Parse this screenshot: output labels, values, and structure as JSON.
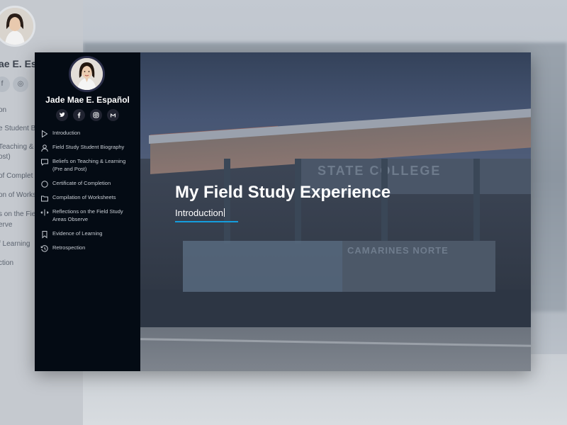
{
  "profile": {
    "name": "Jade Mae E. Español",
    "backdrop_name_fragment": "ae E. Es"
  },
  "socials": [
    {
      "id": "twitter",
      "icon": "twitter-icon",
      "glyph": "t"
    },
    {
      "id": "facebook",
      "icon": "facebook-icon",
      "glyph": "f"
    },
    {
      "id": "instagram",
      "icon": "instagram-icon",
      "glyph": "◎"
    },
    {
      "id": "gmail",
      "icon": "gmail-icon",
      "glyph": "M"
    }
  ],
  "nav": [
    {
      "label": "Introduction",
      "icon": "play-outline-icon"
    },
    {
      "label": "Field Study Student Biography",
      "icon": "user-icon"
    },
    {
      "label": "Beliefs on Teaching & Learning (Pre and Post)",
      "icon": "chat-icon"
    },
    {
      "label": "Certificate of Completion",
      "icon": "circle-icon"
    },
    {
      "label": "Compilation of Worksheets",
      "icon": "folder-icon"
    },
    {
      "label": "Reflections on the Field Study Areas Observe",
      "icon": "split-arrows-icon"
    },
    {
      "label": "Evidence of Learning",
      "icon": "bookmark-icon"
    },
    {
      "label": "Retrospection",
      "icon": "history-icon"
    }
  ],
  "backdrop_nav": [
    "on",
    "e Student B",
    "Teaching &",
    "ost)",
    "of Complet",
    "on of Works",
    "s on the Fie",
    "erve",
    "f Learning",
    "ction"
  ],
  "hero": {
    "title": "My Field Study Experience",
    "subtitle": "Introduction",
    "building_sign": "STATE COLLEGE",
    "wall_sign": "CAMARINES NORTE"
  },
  "colors": {
    "sidebar_bg": "#040b14",
    "accent": "#149ddd",
    "text": "#ffffff"
  }
}
